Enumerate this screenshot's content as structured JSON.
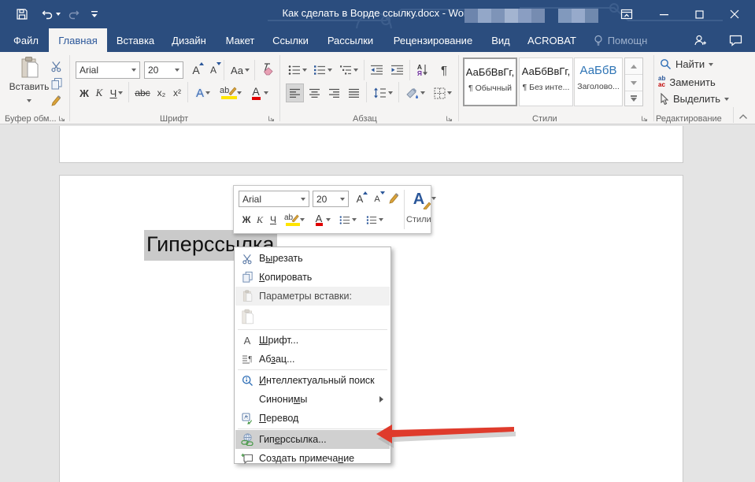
{
  "titlebar": {
    "title": "Как сделать в Ворде ссылку.docx - Word"
  },
  "tabs": {
    "items": [
      {
        "label": "Файл"
      },
      {
        "label": "Главная"
      },
      {
        "label": "Вставка"
      },
      {
        "label": "Дизайн"
      },
      {
        "label": "Макет"
      },
      {
        "label": "Ссылки"
      },
      {
        "label": "Рассылки"
      },
      {
        "label": "Рецензирование"
      },
      {
        "label": "Вид"
      },
      {
        "label": "ACROBAT"
      },
      {
        "label": "Помощн"
      }
    ]
  },
  "ribbon": {
    "clipboard": {
      "paste": "Вставить",
      "label": "Буфер обм..."
    },
    "font": {
      "name": "Arial",
      "size": "20",
      "case": "Aa",
      "bold": "Ж",
      "italic": "К",
      "underline": "Ч",
      "strike": "abc",
      "sub": "x₂",
      "sup": "x²",
      "effects": "А",
      "highlight": "ab",
      "color": "А",
      "label": "Шрифт"
    },
    "paragraph": {
      "sort_a": "А",
      "sort_b": "Я",
      "pilcrow": "¶",
      "label": "Абзац"
    },
    "styles": {
      "label": "Стили",
      "cards": [
        {
          "preview": "АаБбВвГг,",
          "name": "¶ Обычный"
        },
        {
          "preview": "АаБбВвГг,",
          "name": "¶ Без инте..."
        },
        {
          "preview": "АаБбВ",
          "name": "Заголово..."
        }
      ]
    },
    "editing": {
      "find": "Найти",
      "replace": "Заменить",
      "select": "Выделить",
      "replace_ab": "ab",
      "replace_ac": "ас",
      "label": "Редактирование"
    }
  },
  "mini_toolbar": {
    "font_name": "Arial",
    "font_size": "20",
    "styles": "Стили"
  },
  "document": {
    "selected_text": "Гиперссылка"
  },
  "context_menu": {
    "cut": {
      "pre": "В",
      "key": "ы",
      "post": "резать"
    },
    "copy": {
      "pre": "",
      "key": "К",
      "post": "опировать"
    },
    "paste_options": {
      "label": "Параметры вставки:"
    },
    "font": {
      "pre": "",
      "key": "Ш",
      "post": "рифт..."
    },
    "paragraph": {
      "pre": "Аб",
      "key": "з",
      "post": "ац..."
    },
    "smart_lookup": {
      "pre": "",
      "key": "И",
      "post": "нтеллектуальный поиск"
    },
    "synonyms": {
      "pre": "Синони",
      "key": "м",
      "post": "ы"
    },
    "translate": {
      "pre": "",
      "key": "П",
      "post": "еревод"
    },
    "hyperlink": {
      "pre": "Гип",
      "key": "е",
      "post": "рссылка..."
    },
    "new_comment": {
      "pre": "Создать примеча",
      "key": "н",
      "post": "ие"
    }
  },
  "icons": {
    "letter_a": "А",
    "pilcrow": "¶"
  },
  "colors": {
    "titlebar_blue": "#2b4d7e",
    "accent_blue": "#2b579a",
    "arrow_red": "#df3b2c",
    "highlight_yellow": "#ffe500",
    "font_color_red": "#e00000",
    "selection_gray": "#cacaca",
    "menu_highlight": "#d0d0d0"
  }
}
